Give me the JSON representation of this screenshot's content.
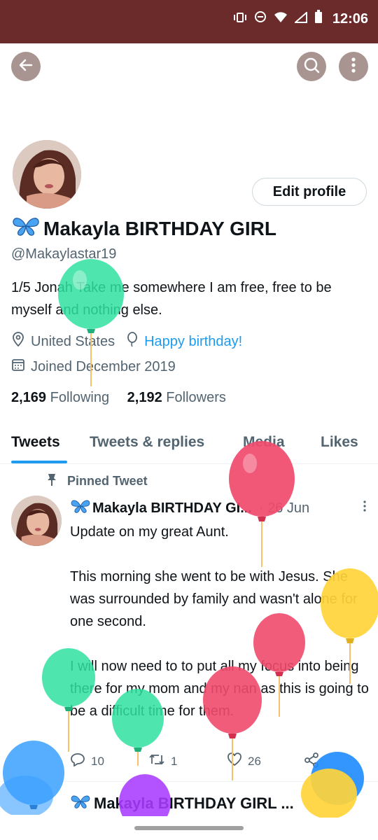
{
  "status_bar": {
    "time": "12:06"
  },
  "profile": {
    "edit_button": "Edit profile",
    "display_name": "Makayla BIRTHDAY GIRL",
    "handle": "@Makaylastar19",
    "bio": "1/5 Jonah Take me somewhere I am free, free to be myself and nothing else.",
    "location": "United States",
    "link": "Happy birthday!",
    "joined": "Joined December 2019",
    "following_count": "2,169",
    "following_label": "Following",
    "followers_count": "2,192",
    "followers_label": "Followers"
  },
  "tabs": [
    "Tweets",
    "Tweets & replies",
    "Media",
    "Likes"
  ],
  "pinned_label": "Pinned Tweet",
  "tweet": {
    "author": "Makayla BIRTHDAY GI...",
    "date": "· 26 Jun",
    "text": "Update on my great Aunt.\n\nThis morning she went to be with Jesus. She was surrounded by family and wasn't alone for one second.\n\nI will now need to to put all my focus into being there for my mom and my nan as this is going to be a difficult time for them.",
    "replies": "10",
    "retweets": "1",
    "likes": "26"
  },
  "next_tweet": {
    "author": "Makayla BIRTHDAY GIRL ..."
  },
  "icons": {
    "back": "back-arrow-icon",
    "search": "search-icon",
    "more": "more-vertical-icon",
    "location": "location-pin-icon",
    "link": "balloon-icon",
    "calendar": "calendar-icon",
    "pin": "pin-icon",
    "reply": "reply-icon",
    "retweet": "retweet-icon",
    "like": "heart-icon",
    "share": "share-icon",
    "emoji": "butterfly-icon"
  },
  "colors": {
    "accent": "#1d9bf0",
    "status_bar": "#6b2b2b",
    "text_secondary": "#536471"
  }
}
